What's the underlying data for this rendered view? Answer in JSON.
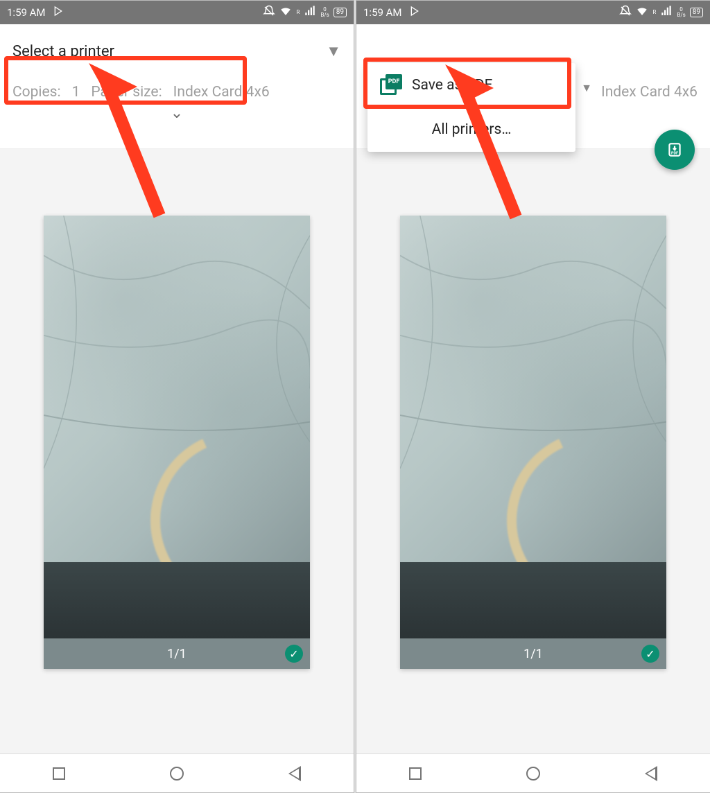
{
  "status": {
    "time": "1:59 AM",
    "battery": "89",
    "net_rate_top": "0",
    "net_rate_unit": "B/s",
    "roaming": "R"
  },
  "left": {
    "printer_label": "Select a printer",
    "copies_label": "Copies:",
    "copies_value": "1",
    "paper_label": "Paper size:",
    "paper_value": "Index Card 4x6",
    "page_counter": "1/1"
  },
  "right": {
    "save_pdf_label": "Save as PDF",
    "all_printers_label": "All printers…",
    "paper_value": "Index Card 4x6",
    "page_counter": "1/1",
    "pdf_badge": "PDF"
  },
  "annotations": {
    "left_highlight": "select-printer-dropdown",
    "right_highlight": "save-as-pdf-option"
  }
}
